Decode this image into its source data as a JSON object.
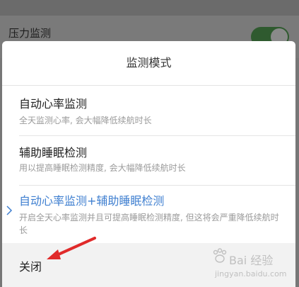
{
  "background": {
    "row_label": "压力监测",
    "toggle_on": true
  },
  "dialog": {
    "title": "监测模式",
    "options": [
      {
        "title": "自动心率监测",
        "desc": "全天监测心率, 会大幅降低续航时长",
        "selected": false
      },
      {
        "title": "辅助睡眠检测",
        "desc": "用以提高睡眠检测精度, 会大幅降低续航时长",
        "selected": false
      },
      {
        "title": "自动心率监测+辅助睡眠检测",
        "desc": "开启全天心率监测并且可提高睡眠检测精度, 但这将会严重降低续航时长",
        "selected": true
      }
    ],
    "close_label": "关闭"
  },
  "watermark": {
    "brand": "Bai 经验",
    "url": "jingyan.baidu.com"
  },
  "colors": {
    "accent": "#3f7fd0",
    "annotation_arrow": "#e02a2a",
    "toggle": "#2f5a2f"
  }
}
